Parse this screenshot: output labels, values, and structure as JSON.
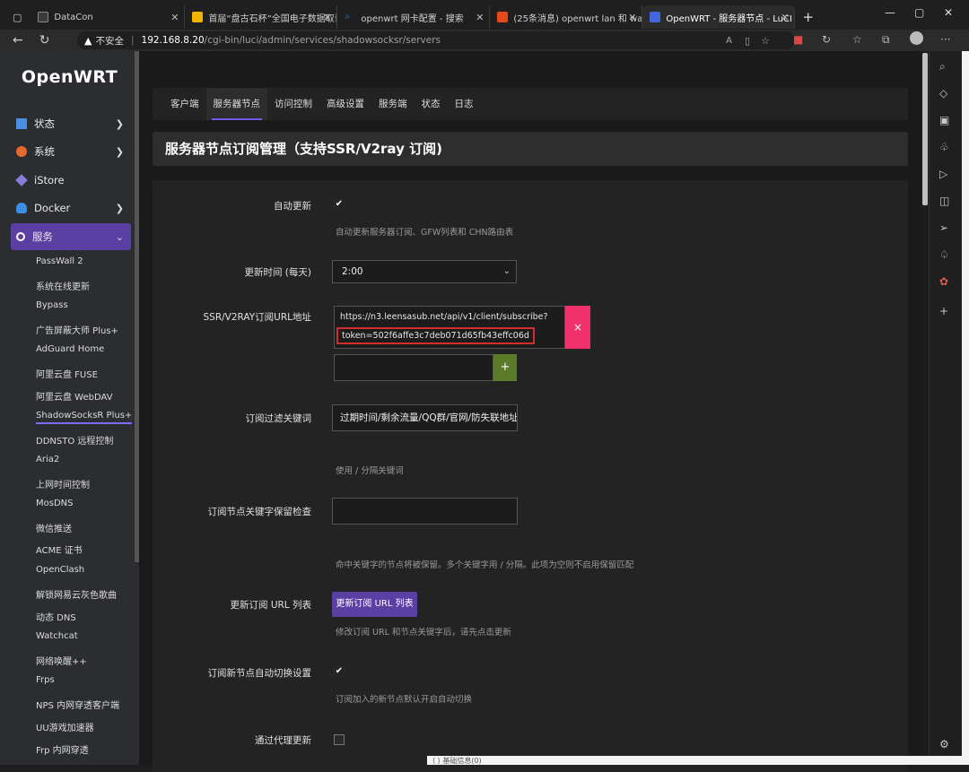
{
  "browser": {
    "tabs": [
      {
        "title": "DataCon",
        "fav_color": "#3a3a3a"
      },
      {
        "title": "首届“盘古石杯”全国电子数据取证",
        "fav_color": "#f0b400"
      },
      {
        "title": "openwrt 网卡配置 - 搜索",
        "fav_color": "#3a78d6"
      },
      {
        "title": "(25条消息) openwrt lan 和 wan的",
        "fav_color": "#e64a19"
      },
      {
        "title": "OpenWRT - 服务器节点 - LuCI",
        "fav_color": "#4466dd"
      }
    ],
    "new_tab": "+",
    "insecure_label": "不安全",
    "url_host": "192.168.8.20",
    "url_path": "/cgi-bin/luci/admin/services/shadowsocksr/servers"
  },
  "sidebar": {
    "logo": "OpenWRT",
    "menus": [
      {
        "label": "状态",
        "icon_color": "#4a90e2",
        "has_arrow": true
      },
      {
        "label": "系统",
        "icon_color": "#e56b2c",
        "has_arrow": true
      },
      {
        "label": "iStore",
        "icon_color": "#8a7dd8",
        "has_arrow": false
      },
      {
        "label": "Docker",
        "icon_color": "#3a8ee6",
        "has_arrow": true
      },
      {
        "label": "服务",
        "icon_color": "#ffffff",
        "has_arrow": true
      }
    ],
    "submenu": [
      "PassWall 2",
      "系统在线更新",
      "Bypass",
      "广告屏蔽大师 Plus+",
      "AdGuard Home",
      "阿里云盘 FUSE",
      "阿里云盘 WebDAV",
      "ShadowSocksR Plus+",
      "DDNSTO 远程控制",
      "Aria2",
      "上网时间控制",
      "MosDNS",
      "微信推送",
      "ACME 证书",
      "OpenClash",
      "解锁网易云灰色歌曲",
      "动态 DNS",
      "Watchcat",
      "网络唤醒++",
      "Frps",
      "NPS 内网穿透客户端",
      "UU游戏加速器",
      "Frp 内网穿透"
    ]
  },
  "tabs": [
    "客户端",
    "服务器节点",
    "访问控制",
    "高级设置",
    "服务端",
    "状态",
    "日志"
  ],
  "page_title": "服务器节点订阅管理（支持SSR/V2ray 订阅)",
  "form": {
    "auto_update_label": "自动更新",
    "auto_update_hint": "自动更新服务器订阅、GFW列表和 CHN路由表",
    "update_time_label": "更新时间 (每天)",
    "update_time_value": "2:00",
    "sub_url_label": "SSR/V2RAY订阅URL地址",
    "sub_url_line1": "https://n3.leensasub.net/api/v1/client/subscribe?",
    "sub_url_line2": "token=502f6affe3c7deb071d65fb43effc06d",
    "delete_button": "×",
    "add_button": "+",
    "filter_label": "订阅过滤关键词",
    "filter_value": "过期时间/剩余流量/QQ群/官网/防失联地址",
    "filter_hint": "使用 / 分隔关键词",
    "keep_label": "订阅节点关键字保留检查",
    "keep_value": "",
    "keep_hint": "命中关键字的节点将被保留。多个关键字用 / 分隔。此项为空则不启用保留匹配",
    "update_list_label": "更新订阅 URL 列表",
    "update_list_button": "更新订阅 URL 列表",
    "update_list_hint": "修改订阅 URL 和节点关键字后，请先点击更新",
    "auto_switch_label": "订阅新节点自动切换设置",
    "auto_switch_hint": "订阅加入的新节点默认开启自动切换",
    "proxy_update_label": "通过代理更新"
  },
  "bottom_peek": "⟨ ⟩ 基础信息(0)"
}
